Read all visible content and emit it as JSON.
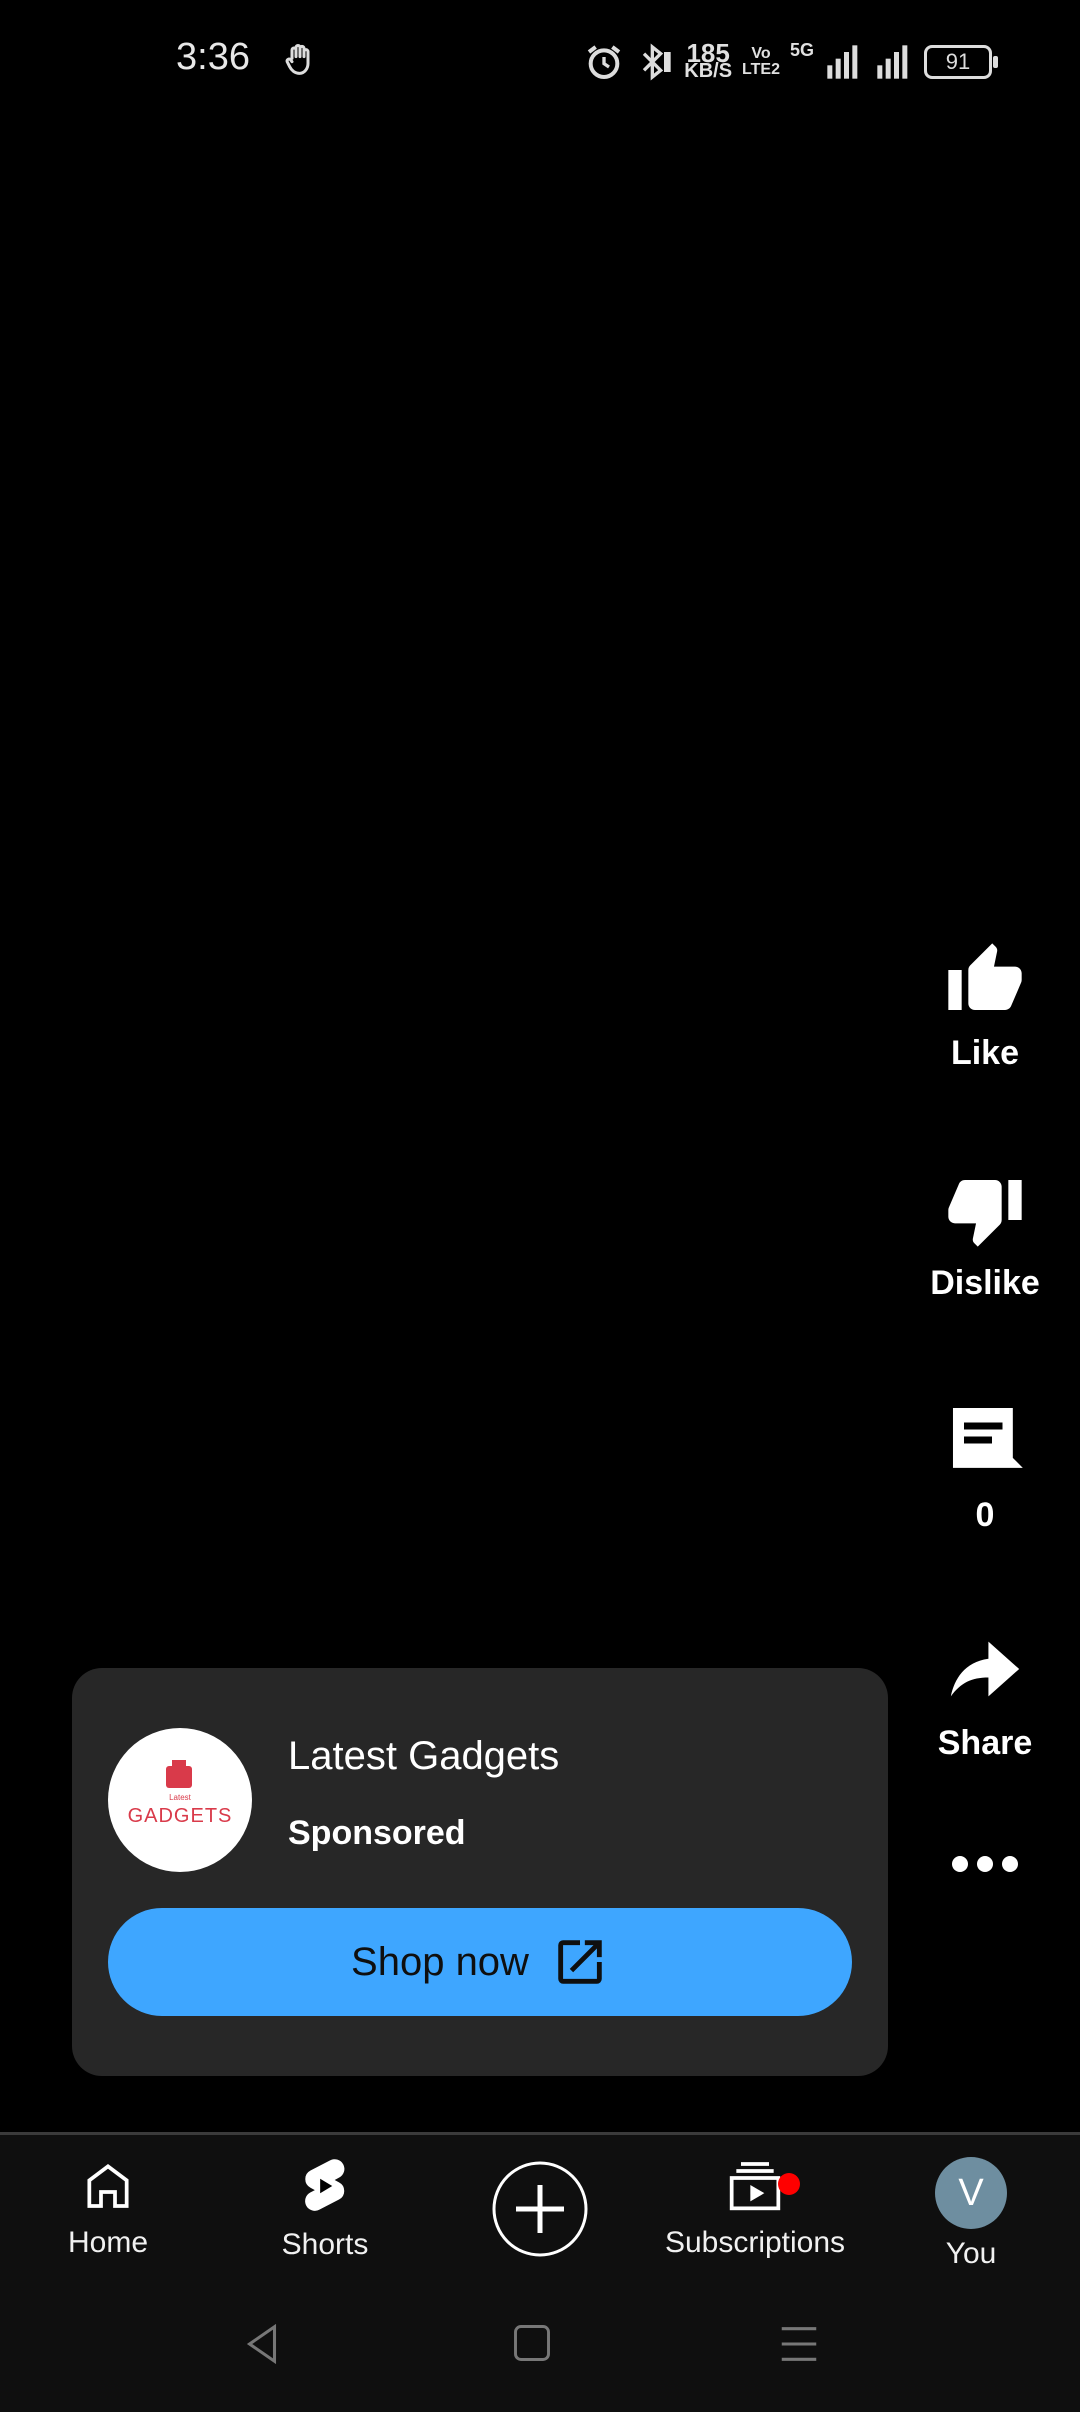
{
  "status_bar": {
    "time": "3:36",
    "network_speed_value": "185",
    "network_speed_unit": "KB/S",
    "volte_top": "Vo",
    "volte_bottom": "LTE2",
    "signal_label": "5G",
    "battery": "91"
  },
  "actions": {
    "like_label": "Like",
    "dislike_label": "Dislike",
    "comments_count": "0",
    "share_label": "Share"
  },
  "ad": {
    "advertiser_name": "Latest Gadgets",
    "sponsored_label": "Sponsored",
    "cta_label": "Shop now",
    "logo_text_small": "Latest",
    "logo_text": "GADGETS",
    "brand_color": "#d93a4a"
  },
  "bottom_nav": {
    "items": [
      {
        "label": "Home",
        "icon": "home-icon"
      },
      {
        "label": "Shorts",
        "icon": "shorts-icon"
      },
      {
        "label": "",
        "icon": "create-icon"
      },
      {
        "label": "Subscriptions",
        "icon": "subscriptions-icon"
      },
      {
        "label": "You",
        "icon": "avatar"
      }
    ],
    "avatar_initial": "V"
  },
  "colors": {
    "cta_background": "#3ea6ff",
    "card_background": "#272727",
    "notification_dot": "#ff0000"
  }
}
